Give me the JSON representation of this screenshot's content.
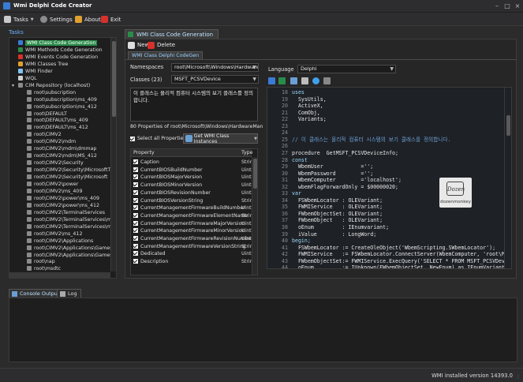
{
  "window": {
    "title": "Wmi Delphi Code Creator"
  },
  "menu": {
    "tasks": "Tasks",
    "settings": "Settings",
    "about": "About",
    "exit": "Exit"
  },
  "tasks_panel": {
    "label": "Tasks",
    "items": [
      {
        "label": "WMI Class Code Generation",
        "level": 1,
        "icon": "class-gen-icon",
        "selected": true
      },
      {
        "label": "WMI Methods Code Generation",
        "level": 1,
        "icon": "methods-icon"
      },
      {
        "label": "WMI Events Code Generation",
        "level": 1,
        "icon": "events-icon"
      },
      {
        "label": "WMI Classes Tree",
        "level": 1,
        "icon": "tree-icon"
      },
      {
        "label": "WMI Finder",
        "level": 1,
        "icon": "finder-icon"
      },
      {
        "label": "WQL",
        "level": 1,
        "icon": "wql-icon"
      },
      {
        "label": "CIM Repository (localhost)",
        "level": 1,
        "icon": "repository-icon"
      },
      {
        "label": "root\\subscription",
        "level": 2,
        "icon": "namespace-icon"
      },
      {
        "label": "root\\subscription\\ms_409",
        "level": 2,
        "icon": "namespace-icon"
      },
      {
        "label": "root\\subscription\\ms_412",
        "level": 2,
        "icon": "namespace-icon"
      },
      {
        "label": "root\\DEFAULT",
        "level": 2,
        "icon": "namespace-icon"
      },
      {
        "label": "root\\DEFAULT\\ms_409",
        "level": 2,
        "icon": "namespace-icon"
      },
      {
        "label": "root\\DEFAULT\\ms_412",
        "level": 2,
        "icon": "namespace-icon"
      },
      {
        "label": "root\\CIMV2",
        "level": 2,
        "icon": "namespace-icon"
      },
      {
        "label": "root\\CIMV2\\mdm",
        "level": 2,
        "icon": "namespace-icon"
      },
      {
        "label": "root\\CIMV2\\mdm\\dmmap",
        "level": 2,
        "icon": "namespace-icon"
      },
      {
        "label": "root\\CIMV2\\mdm\\MS_412",
        "level": 2,
        "icon": "namespace-icon"
      },
      {
        "label": "root\\CIMV2\\Security",
        "level": 2,
        "icon": "namespace-icon"
      },
      {
        "label": "root\\CIMV2\\Security\\MicrosoftT",
        "level": 2,
        "icon": "namespace-icon"
      },
      {
        "label": "root\\CIMV2\\Security\\Microsoft",
        "level": 2,
        "icon": "namespace-icon"
      },
      {
        "label": "root\\CIMV2\\power",
        "level": 2,
        "icon": "namespace-icon"
      },
      {
        "label": "root\\CIMV2\\ms_409",
        "level": 2,
        "icon": "namespace-icon"
      },
      {
        "label": "root\\CIMV2\\power\\ms_409",
        "level": 2,
        "icon": "namespace-icon"
      },
      {
        "label": "root\\CIMV2\\power\\ms_412",
        "level": 2,
        "icon": "namespace-icon"
      },
      {
        "label": "root\\CIMV2\\TerminalServices",
        "level": 2,
        "icon": "namespace-icon"
      },
      {
        "label": "root\\CIMV2\\TerminalServices\\m",
        "level": 2,
        "icon": "namespace-icon"
      },
      {
        "label": "root\\CIMV2\\TerminalServices\\m",
        "level": 2,
        "icon": "namespace-icon"
      },
      {
        "label": "root\\CIMV2\\ms_412",
        "level": 2,
        "icon": "namespace-icon"
      },
      {
        "label": "root\\CIMV2\\Applications",
        "level": 2,
        "icon": "namespace-icon"
      },
      {
        "label": "root\\CIMV2\\Applications\\Games",
        "level": 2,
        "icon": "namespace-icon"
      },
      {
        "label": "root\\CIMV2\\Applications\\Games",
        "level": 2,
        "icon": "namespace-icon"
      },
      {
        "label": "root\\nap",
        "level": 2,
        "icon": "namespace-icon"
      },
      {
        "label": "root\\msdtc",
        "level": 2,
        "icon": "namespace-icon"
      },
      {
        "label": "root\\Cli",
        "level": 2,
        "icon": "namespace-icon"
      }
    ]
  },
  "main_tab": "WMI Class Code Generation",
  "sub_tab": "WMI Class Delphi CodeGen",
  "toolbar": {
    "new": "New",
    "delete": "Delete"
  },
  "form": {
    "namespaces_label": "Namespaces",
    "namespace_value": "root\\Microsoft\\Windows\\Hardware",
    "classes_label": "Classes (23)",
    "class_value": "MSFT_PCSVDevice",
    "description": "이 클래스는 물리적 컴퓨터 시스템의 보기 클래스를 정의합니다.",
    "properties_count_text": "80 Properties of root\\Microsoft\\Windows\\HardwareManag",
    "select_all_label": "Select all Properties",
    "get_instances_label": "Get WMI Class Instances",
    "language_label": "Language",
    "language_value": "Delphi"
  },
  "property_grid": {
    "headers": [
      "Property",
      "Type"
    ],
    "rows": [
      {
        "name": "Caption",
        "type": "Strin"
      },
      {
        "name": "CurrentBIOSBuildNumber",
        "type": "Uint"
      },
      {
        "name": "CurrentBIOSMajorVersion",
        "type": "Uint"
      },
      {
        "name": "CurrentBIOSMinorVersion",
        "type": "Uint"
      },
      {
        "name": "CurrentBIOSRevisionNumber",
        "type": "Uint"
      },
      {
        "name": "CurrentBIOSVersionString",
        "type": "Strin"
      },
      {
        "name": "CurrentManagementFirmwareBuildNumber",
        "type": "Uint"
      },
      {
        "name": "CurrentManagementFirmwareElementName",
        "type": "Strin"
      },
      {
        "name": "CurrentManagementFirmwareMajorVersion",
        "type": "Uint"
      },
      {
        "name": "CurrentManagementFirmwareMinorVersion",
        "type": "Uint"
      },
      {
        "name": "CurrentManagementFirmwareRevisionNumber",
        "type": "Uint"
      },
      {
        "name": "CurrentManagementFirmwareVersionString",
        "type": "Strin"
      },
      {
        "name": "Dedicated",
        "type": "Uint"
      },
      {
        "name": "Description",
        "type": "Strin"
      }
    ]
  },
  "code": {
    "lines": [
      {
        "n": "18",
        "t": "uses",
        "c": "#9cdcfe"
      },
      {
        "n": "19",
        "t": "  SysUtils,",
        "c": "#e6e6e6"
      },
      {
        "n": "20",
        "t": "  ActiveX,",
        "c": "#e6e6e6"
      },
      {
        "n": "21",
        "t": "  ComObj,",
        "c": "#e6e6e6"
      },
      {
        "n": "22",
        "t": "  Variants;",
        "c": "#e6e6e6"
      },
      {
        "n": "23",
        "t": "",
        "c": "#e6e6e6"
      },
      {
        "n": "24",
        "t": "",
        "c": "#e6e6e6"
      },
      {
        "n": "25",
        "t": "// 이 클래스는 물리적 컴퓨터 시스템의 보기 클래스를 정의합니다.",
        "c": "#6a9fd4"
      },
      {
        "n": "26",
        "t": "",
        "c": "#e6e6e6"
      },
      {
        "n": "27",
        "t": "procedure  GetMSFT_PCSVDeviceInfo;",
        "c": "#e6e6e6"
      },
      {
        "n": "28",
        "t": "const",
        "c": "#9cdcfe"
      },
      {
        "n": "29",
        "t": "  WbemUser            ='';",
        "c": "#e6e6e6"
      },
      {
        "n": "30",
        "t": "  WbemPassword        ='';",
        "c": "#e6e6e6"
      },
      {
        "n": "31",
        "t": "  WbemComputer        ='localhost';",
        "c": "#e6e6e6"
      },
      {
        "n": "32",
        "t": "  wbemFlagForwardOnly = $00000020;",
        "c": "#e6e6e6"
      },
      {
        "n": "33",
        "t": "var",
        "c": "#9cdcfe"
      },
      {
        "n": "34",
        "t": "  FSWbemLocator : OLEVariant;",
        "c": "#e6e6e6"
      },
      {
        "n": "35",
        "t": "  FWMIService   : OLEVariant;",
        "c": "#e6e6e6"
      },
      {
        "n": "36",
        "t": "  FWbemObjectSet: OLEVariant;",
        "c": "#e6e6e6"
      },
      {
        "n": "37",
        "t": "  FWbemObject   : OLEVariant;",
        "c": "#e6e6e6"
      },
      {
        "n": "38",
        "t": "  oEnum         : IEnumvariant;",
        "c": "#e6e6e6"
      },
      {
        "n": "39",
        "t": "  iValue        : LongWord;",
        "c": "#e6e6e6"
      },
      {
        "n": "40",
        "t": "begin;",
        "c": "#9cdcfe"
      },
      {
        "n": "41",
        "t": "  FSWbemLocator := CreateOleObject('WbemScripting.SWbemLocator');",
        "c": "#e6e6e6"
      },
      {
        "n": "42",
        "t": "  FWMIService   := FSWbemLocator.ConnectServer(WbemComputer, 'root\\Mi",
        "c": "#e6e6e6"
      },
      {
        "n": "43",
        "t": "  FWbemObjectSet:= FWMIService.ExecQuery('SELECT * FROM MSFT_PCSVDevi",
        "c": "#e6e6e6"
      },
      {
        "n": "44",
        "t": "  oEnum         := IUnknown(FWbemObjectSet._NewEnum) as IEnumVariant;",
        "c": "#e6e6e6"
      }
    ]
  },
  "watermark": {
    "text": "dozenmonkey",
    "logo": "Dozen"
  },
  "bottom_tabs": {
    "console": "Console Output",
    "log": "Log"
  },
  "status": {
    "text": "WMI installed version 14393.0"
  },
  "colors": {
    "accent": "#6ab0ff",
    "selection": "#2a8c4a",
    "background": "#2b2b2b"
  }
}
